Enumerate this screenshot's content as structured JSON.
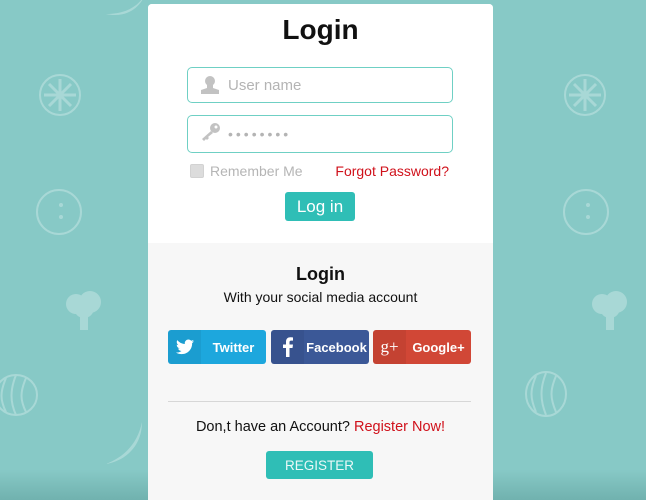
{
  "login": {
    "title": "Login",
    "username": {
      "placeholder": "User name",
      "value": "",
      "icon": "user-icon"
    },
    "password": {
      "value": "••••••••",
      "icon": "key-icon"
    },
    "remember_label": "Remember Me",
    "remember_checked": false,
    "forgot_label": "Forgot Password?",
    "login_button": "Log in"
  },
  "social": {
    "title": "Login",
    "subtitle": "With your social media account",
    "buttons": [
      {
        "label": "Twitter",
        "icon": "twitter-icon",
        "color": "#1da7dd"
      },
      {
        "label": "Facebook",
        "icon": "facebook-icon",
        "color": "#3b5897"
      },
      {
        "label": "Google+",
        "icon": "google-plus-icon",
        "color": "#d14736"
      }
    ]
  },
  "register": {
    "prompt": "Don,t have an Account?",
    "link": "Register Now!",
    "button": "REGISTER"
  },
  "colors": {
    "background": "#87c9c6",
    "accent": "#2fbeb6",
    "link_red": "#d0111b",
    "input_border": "#6fd0c4"
  }
}
